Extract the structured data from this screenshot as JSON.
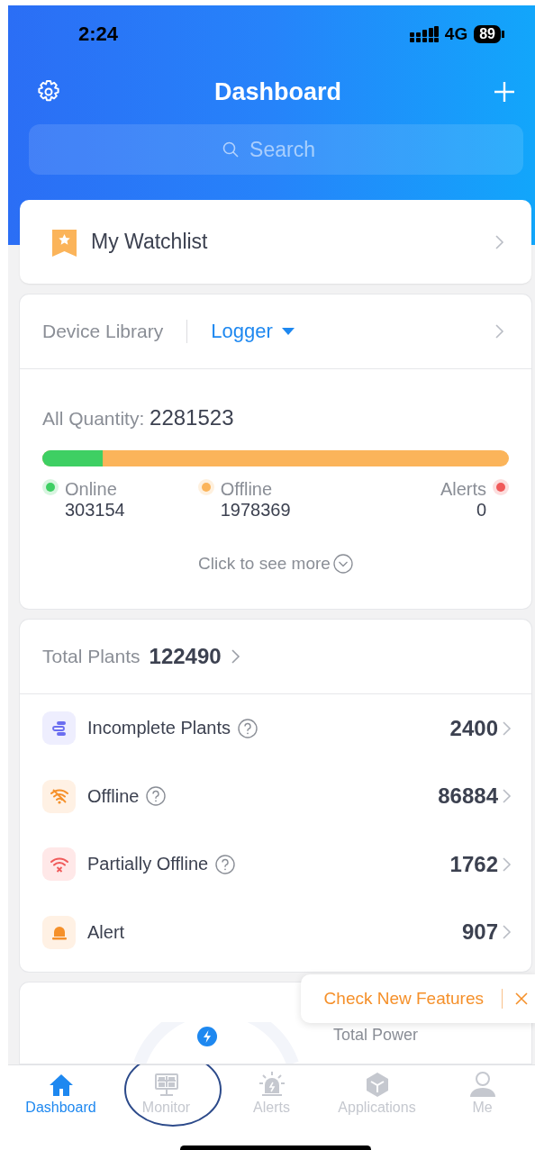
{
  "status_bar": {
    "time": "2:24",
    "network": "4G",
    "battery": "89"
  },
  "header": {
    "title": "Dashboard"
  },
  "search": {
    "placeholder": "Search"
  },
  "watchlist": {
    "label": "My Watchlist"
  },
  "device_library": {
    "title": "Device Library",
    "type": "Logger",
    "quantity_label": "All Quantity:",
    "quantity": "2281523",
    "level": 0.13,
    "statuses": [
      {
        "label": "Online",
        "value": "303154",
        "color": "#3ecf63"
      },
      {
        "label": "Offline",
        "value": "1978369",
        "color": "#fbb45a"
      },
      {
        "label": "Alerts",
        "value": "0",
        "color": "#f05a5a"
      }
    ],
    "more": "Click to see more"
  },
  "plants": {
    "label": "Total Plants",
    "total": "122490",
    "rows": [
      {
        "kind": "incomplete",
        "label": "Incomplete Plants",
        "help": true,
        "value": "2400"
      },
      {
        "kind": "offline",
        "label": "Offline",
        "help": true,
        "value": "86884"
      },
      {
        "kind": "partial",
        "label": "Partially Offline",
        "help": true,
        "value": "1762"
      },
      {
        "kind": "alert",
        "label": "Alert",
        "help": false,
        "value": "907"
      }
    ]
  },
  "power": {
    "label": "Total Power"
  },
  "toast": {
    "text": "Check New Features"
  },
  "tabs": [
    {
      "kind": "home",
      "label": "Dashboard",
      "selected": true
    },
    {
      "kind": "monitor",
      "label": "Monitor",
      "selected": false
    },
    {
      "kind": "alerts",
      "label": "Alerts",
      "selected": false
    },
    {
      "kind": "applications",
      "label": "Applications",
      "selected": false
    },
    {
      "kind": "me",
      "label": "Me",
      "selected": false
    }
  ]
}
